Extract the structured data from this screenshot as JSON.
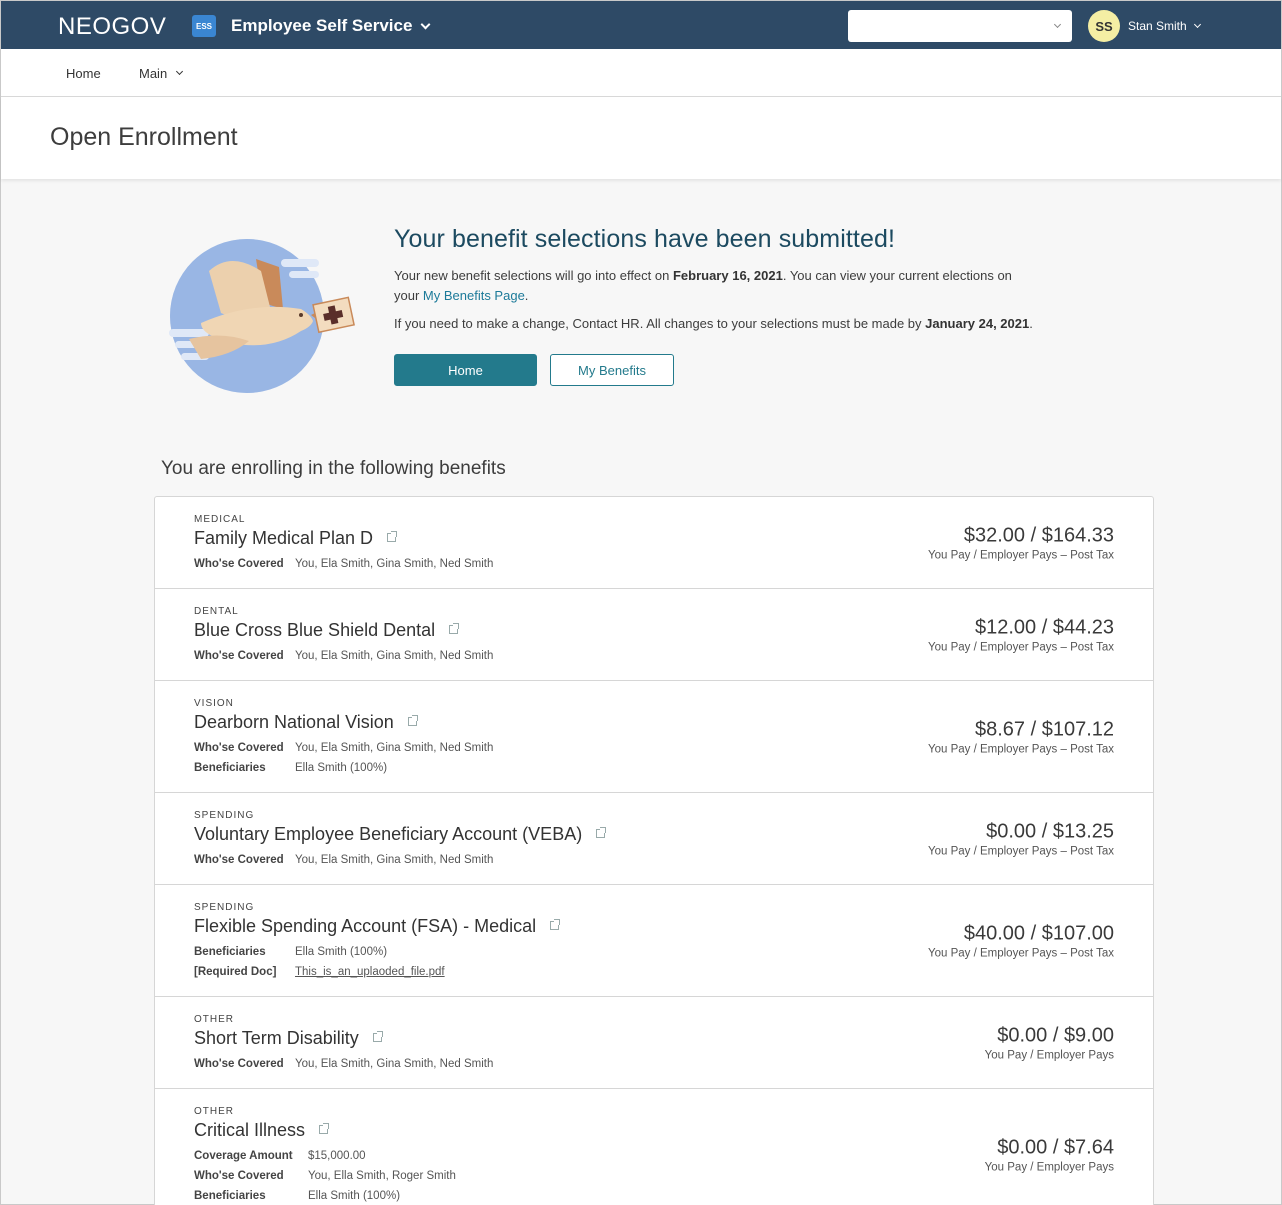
{
  "topbar": {
    "brand": "NEOGOV",
    "app_badge": "ESS",
    "app_name": "Employee Self Service",
    "select_value": "",
    "avatar_initials": "SS",
    "user_name": "Stan Smith",
    "colors": {
      "bar": "#2e4a66",
      "badge": "#3a86d2",
      "avatar": "#f4eea4"
    }
  },
  "nav": {
    "home": "Home",
    "main": "Main"
  },
  "page": {
    "title": "Open Enrollment"
  },
  "confirmation": {
    "heading": "Your benefit selections have been submitted!",
    "p1_pre": "Your new benefit selections will go into effect on ",
    "p1_date": "February 16, 2021",
    "p1_mid": ". You can view your current elections on your ",
    "p1_link": "My Benefits Page",
    "p1_end": ".",
    "p2_pre": "If you need to make a change, Contact HR. All changes to your selections must be made by ",
    "p2_date": "January 24, 2021",
    "p2_end": ".",
    "home_button": "Home",
    "my_benefits_button": "My Benefits"
  },
  "benefits": {
    "heading": "You are enrolling in the following benefits",
    "items": [
      {
        "category": "MEDICAL",
        "name": "Family Medical Plan D",
        "details": [
          {
            "label": "Who'se Covered",
            "value": "You, Ela Smith, Gina Smith, Ned Smith"
          }
        ],
        "price": "$32.00 / $164.33",
        "price_note": "You Pay / Employer Pays – Post Tax"
      },
      {
        "category": "DENTAL",
        "name": "Blue Cross Blue Shield Dental",
        "details": [
          {
            "label": "Who'se Covered",
            "value": "You, Ela Smith, Gina Smith, Ned Smith"
          }
        ],
        "price": "$12.00 / $44.23",
        "price_note": "You Pay / Employer Pays – Post Tax"
      },
      {
        "category": "VISION",
        "name": "Dearborn National Vision",
        "details": [
          {
            "label": "Who'se Covered",
            "value": "You, Ela Smith, Gina Smith, Ned Smith"
          },
          {
            "label": "Beneficiaries",
            "value": "Ella Smith (100%)"
          }
        ],
        "price": "$8.67 / $107.12",
        "price_note": "You Pay / Employer Pays – Post Tax"
      },
      {
        "category": "SPENDING",
        "name": "Voluntary Employee Beneficiary Account (VEBA)",
        "details": [
          {
            "label": "Who'se Covered",
            "value": "You, Ela Smith, Gina Smith, Ned Smith"
          }
        ],
        "price": "$0.00 / $13.25",
        "price_note": "You Pay / Employer Pays – Post Tax"
      },
      {
        "category": "SPENDING",
        "name": "Flexible Spending Account (FSA) - Medical",
        "details": [
          {
            "label": "Beneficiaries",
            "value": "Ella Smith (100%)"
          },
          {
            "label": "[Required Doc]",
            "value": "This_is_an_uplaoded_file.pdf"
          }
        ],
        "price": "$40.00 / $107.00",
        "price_note": "You Pay / Employer Pays – Post Tax"
      },
      {
        "category": "OTHER",
        "name": "Short Term Disability",
        "details": [
          {
            "label": "Who'se Covered",
            "value": "You, Ela Smith, Gina Smith, Ned Smith"
          }
        ],
        "price": "$0.00 / $9.00",
        "price_note": "You Pay / Employer Pays"
      },
      {
        "category": "OTHER",
        "name": "Critical Illness",
        "details": [
          {
            "label": "Coverage Amount",
            "value": "$15,000.00"
          },
          {
            "label": "Who'se Covered",
            "value": "You, Ella Smith, Roger Smith"
          },
          {
            "label": "Beneficiaries",
            "value": "Ella Smith (100%)"
          }
        ],
        "price": "$0.00 / $7.64",
        "price_note": "You Pay / Employer Pays"
      }
    ]
  },
  "colors": {
    "accent": "#237a8c",
    "heading": "#1c4a60",
    "link": "#1c7a99"
  }
}
